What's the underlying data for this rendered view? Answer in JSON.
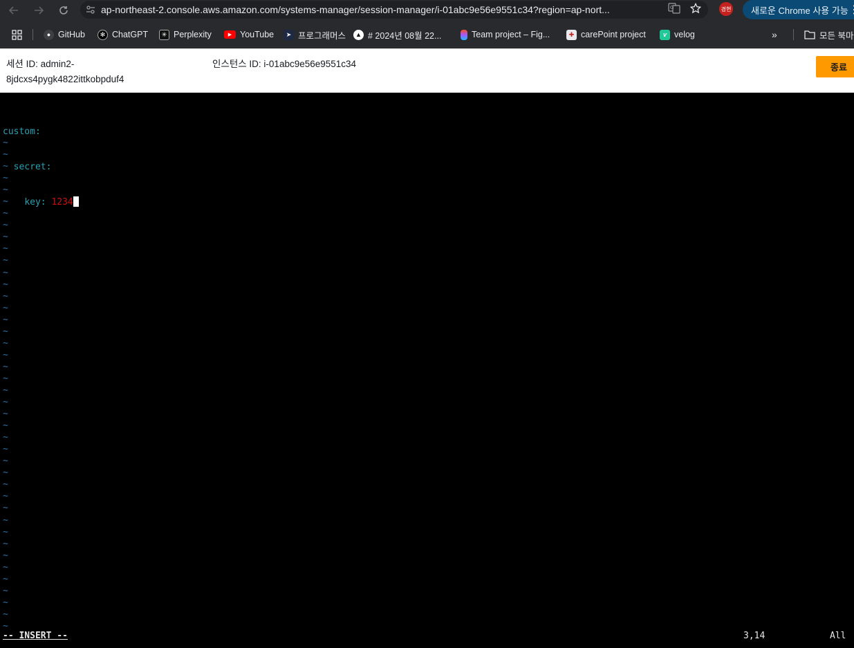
{
  "browser": {
    "url": "ap-northeast-2.console.aws.amazon.com/systems-manager/session-manager/i-01abc9e56e9551c34?region=ap-nort...",
    "avatar_text": "경현",
    "new_chrome_label": "새로운 Chrome 사용 가능",
    "bookmarks": [
      {
        "label": "GitHub",
        "icon": "github-icon"
      },
      {
        "label": "ChatGPT",
        "icon": "chatgpt-icon"
      },
      {
        "label": "Perplexity",
        "icon": "perplexity-icon"
      },
      {
        "label": "YouTube",
        "icon": "youtube-icon"
      },
      {
        "label": "프로그래머스",
        "icon": "programmers-icon"
      },
      {
        "label": "# 2024년 08월 22...",
        "icon": "notion-icon"
      },
      {
        "label": "Team project – Fig...",
        "icon": "figma-icon"
      },
      {
        "label": "carePoint project",
        "icon": "carepoint-icon"
      },
      {
        "label": "velog",
        "icon": "velog-icon"
      }
    ],
    "all_bookmarks_label": "모든 북마크"
  },
  "session": {
    "session_id_line1": "세션 ID: admin2-",
    "session_id_line2": "8jdcxs4pygk4822ittkobpduf4",
    "instance_id": "인스턴스 ID: i-01abc9e56e9551c34",
    "terminate_label": "종료"
  },
  "terminal": {
    "lines": [
      {
        "indent": "",
        "key": "custom",
        "sep": ":",
        "value": ""
      },
      {
        "indent": "  ",
        "key": "secret",
        "sep": ":",
        "value": ""
      },
      {
        "indent": "    ",
        "key": "key",
        "sep": ": ",
        "value": "1234"
      }
    ],
    "tilde_count": 42,
    "mode_prefix": "-- ",
    "mode": "INSERT",
    "mode_suffix": " --",
    "cursor_position": "3,14",
    "scroll_position": "All"
  }
}
